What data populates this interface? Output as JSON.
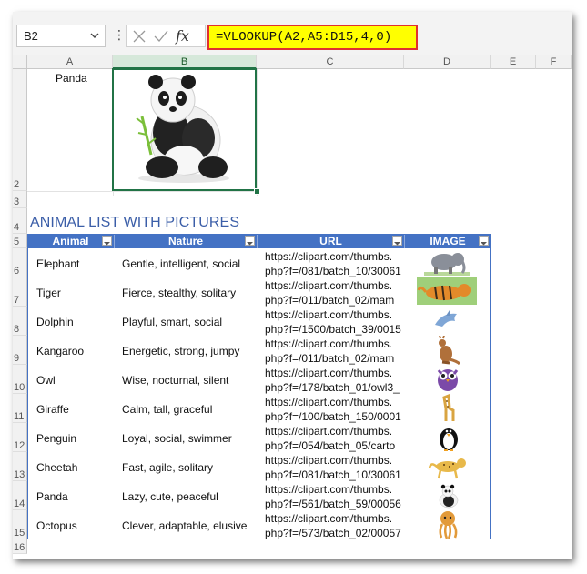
{
  "name_box": {
    "value": "B2"
  },
  "formula_bar": {
    "fx_label": "fx",
    "formula": "=VLOOKUP(A2,A5:D15,4,0)"
  },
  "columns": [
    "A",
    "B",
    "C",
    "D",
    "E",
    "F"
  ],
  "rows": [
    "2",
    "3",
    "4",
    "5",
    "6",
    "7",
    "8",
    "9",
    "10",
    "11",
    "12",
    "13",
    "14",
    "15",
    "16"
  ],
  "lookup": {
    "a2_value": "Panda",
    "b2_picture": "panda-icon"
  },
  "list_title": "ANIMAL LIST WITH PICTURES",
  "table": {
    "headers": [
      "Animal",
      "Nature",
      "URL",
      "IMAGE"
    ],
    "rows": [
      {
        "animal": "Elephant",
        "nature": "Gentle, intelligent, social",
        "url1": "https://clipart.com/thumbs.",
        "url2": "php?f=/081/batch_10/30061",
        "image": "elephant-icon"
      },
      {
        "animal": "Tiger",
        "nature": "Fierce, stealthy, solitary",
        "url1": "https://clipart.com/thumbs.",
        "url2": "php?f=/011/batch_02/mam",
        "image": "tiger-icon"
      },
      {
        "animal": "Dolphin",
        "nature": "Playful, smart, social",
        "url1": "https://clipart.com/thumbs.",
        "url2": "php?f=/1500/batch_39/0015",
        "image": "dolphin-icon"
      },
      {
        "animal": "Kangaroo",
        "nature": "Energetic, strong, jumpy",
        "url1": "https://clipart.com/thumbs.",
        "url2": "php?f=/011/batch_02/mam",
        "image": "kangaroo-icon"
      },
      {
        "animal": "Owl",
        "nature": "Wise, nocturnal, silent",
        "url1": "https://clipart.com/thumbs.",
        "url2": "php?f=/178/batch_01/owl3_",
        "image": "owl-icon"
      },
      {
        "animal": "Giraffe",
        "nature": "Calm, tall, graceful",
        "url1": "https://clipart.com/thumbs.",
        "url2": "php?f=/100/batch_150/0001",
        "image": "giraffe-icon"
      },
      {
        "animal": "Penguin",
        "nature": "Loyal, social, swimmer",
        "url1": "https://clipart.com/thumbs.",
        "url2": "php?f=/054/batch_05/carto",
        "image": "penguin-icon"
      },
      {
        "animal": "Cheetah",
        "nature": "Fast, agile, solitary",
        "url1": "https://clipart.com/thumbs.",
        "url2": "php?f=/081/batch_10/30061",
        "image": "cheetah-icon"
      },
      {
        "animal": "Panda",
        "nature": "Lazy, cute, peaceful",
        "url1": "https://clipart.com/thumbs.",
        "url2": "php?f=/561/batch_59/00056",
        "image": "panda-icon"
      },
      {
        "animal": "Octopus",
        "nature": "Clever, adaptable, elusive",
        "url1": "https://clipart.com/thumbs.",
        "url2": "php?f=/573/batch_02/00057",
        "image": "octopus-icon"
      }
    ]
  },
  "colors": {
    "accent": "#217346",
    "table_header": "#4472c4",
    "formula_highlight": "#ffff00",
    "formula_border": "#e03030"
  }
}
